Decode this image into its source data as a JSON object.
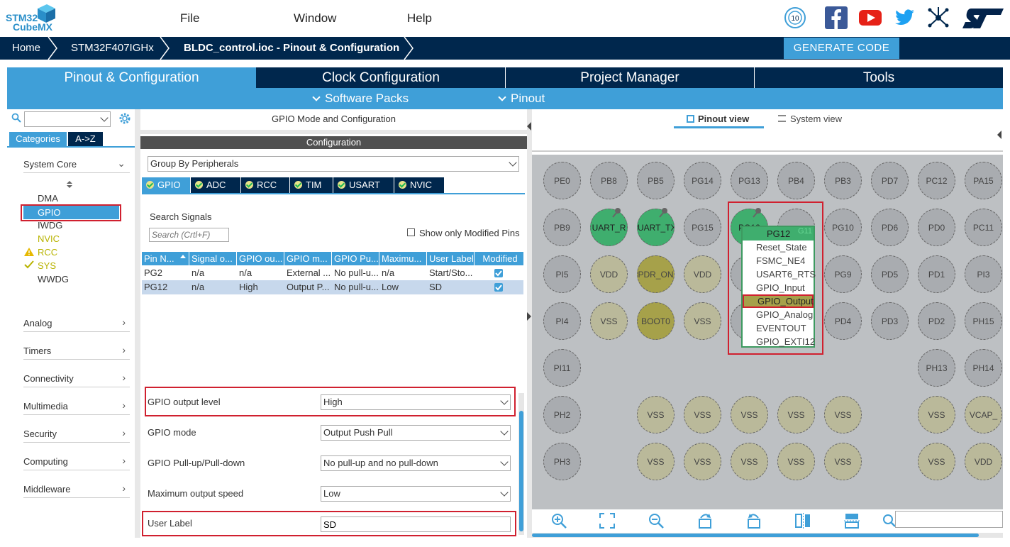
{
  "app": {
    "logo_top": "STM32",
    "logo_bottom": "CubeMX"
  },
  "menu": [
    "File",
    "Window",
    "Help"
  ],
  "social_icons": [
    "anniversary-badge-icon",
    "facebook-icon",
    "youtube-icon",
    "twitter-icon",
    "network-icon",
    "st-logo-icon"
  ],
  "breadcrumb": [
    "Home",
    "STM32F407IGHx",
    "BLDC_control.ioc - Pinout & Configuration"
  ],
  "generate_label": "GENERATE CODE",
  "main_tabs": [
    "Pinout & Configuration",
    "Clock Configuration",
    "Project Manager",
    "Tools"
  ],
  "sub_tabs": [
    "Software Packs",
    "Pinout"
  ],
  "left": {
    "search_value": "",
    "view_tabs": [
      "Categories",
      "A->Z"
    ],
    "system_core": "System Core",
    "system_core_items": [
      "DMA",
      "GPIO",
      "IWDG",
      "NVIC",
      "RCC",
      "SYS",
      "WWDG"
    ],
    "sections": [
      "Analog",
      "Timers",
      "Connectivity",
      "Multimedia",
      "Security",
      "Computing",
      "Middleware"
    ]
  },
  "mid": {
    "title": "GPIO Mode and Configuration",
    "config_label": "Configuration",
    "group_by": "Group By Peripherals",
    "periph_tabs": [
      "GPIO",
      "ADC",
      "RCC",
      "TIM",
      "USART",
      "NVIC"
    ],
    "search_label": "Search Signals",
    "search_placeholder": "Search (Crtl+F)",
    "show_modified": "Show only Modified Pins",
    "table_headers": [
      "Pin N...",
      "Signal o...",
      "GPIO ou...",
      "GPIO m...",
      "GPIO Pu...",
      "Maximu...",
      "User Label",
      "Modified"
    ],
    "rows": [
      [
        "PG2",
        "n/a",
        "n/a",
        "External ...",
        "No pull-u...",
        "n/a",
        "Start/Sto..."
      ],
      [
        "PG12",
        "n/a",
        "High",
        "Output P...",
        "No pull-u...",
        "Low",
        "SD"
      ]
    ],
    "config": [
      {
        "label": "GPIO output level",
        "value": "High"
      },
      {
        "label": "GPIO mode",
        "value": "Output Push Pull"
      },
      {
        "label": "GPIO Pull-up/Pull-down",
        "value": "No pull-up and no pull-down"
      },
      {
        "label": "Maximum output speed",
        "value": "Low"
      },
      {
        "label": "User Label",
        "value": "SD"
      }
    ]
  },
  "right": {
    "view_tabs": [
      "Pinout view",
      "System view"
    ],
    "pins": [
      [
        "PE0",
        "PB8",
        "PB5",
        "PG14",
        "PG13",
        "PB4",
        "PB3",
        "PD7",
        "PC12",
        "PA15"
      ],
      [
        "PB9",
        "UART_R",
        "UART_TX",
        "PG15",
        "PG12",
        "",
        "PG10",
        "PD6",
        "PD0",
        "PC11"
      ],
      [
        "PI5",
        "VDD",
        "PDR_ON",
        "VDD",
        "",
        "",
        "PG9",
        "PD5",
        "PD1",
        "PI3"
      ],
      [
        "PI4",
        "VSS",
        "BOOT0",
        "VSS",
        "",
        "",
        "PD4",
        "PD3",
        "PD2",
        "PH15"
      ],
      [
        "PI11",
        "",
        "",
        "",
        "",
        "",
        "",
        "",
        "PH13",
        "PH14"
      ],
      [
        "PH2",
        "",
        "VSS",
        "VSS",
        "VSS",
        "VSS",
        "VSS",
        "",
        "VSS",
        "VCAP_"
      ],
      [
        "PH3",
        "",
        "VSS",
        "VSS",
        "VSS",
        "VSS",
        "VSS",
        "",
        "VSS",
        "VDD"
      ]
    ],
    "context_menu": {
      "title": "PG12",
      "items": [
        "Reset_State",
        "FSMC_NE4",
        "USART6_RTS",
        "GPIO_Input",
        "GPIO_Output",
        "GPIO_Analog",
        "EVENTOUT",
        "GPIO_EXTI12"
      ]
    },
    "behind_pin_label": "G11",
    "zoom_tools": [
      "zoom-in-icon",
      "fit-screen-icon",
      "zoom-out-icon",
      "rotate-right-icon",
      "rotate-left-icon",
      "flip-vertical-icon",
      "flip-horizontal-icon",
      "search-icon"
    ]
  },
  "colors": {
    "navy": "#00274d",
    "blue": "#3f9fd8",
    "red": "#d0202f",
    "pin_green": "#3fae6e",
    "pin_gray": "#a9acb0",
    "pin_tan": "#bab99a",
    "pin_olive": "#a6a14a",
    "yellow_text": "#b8b300"
  }
}
